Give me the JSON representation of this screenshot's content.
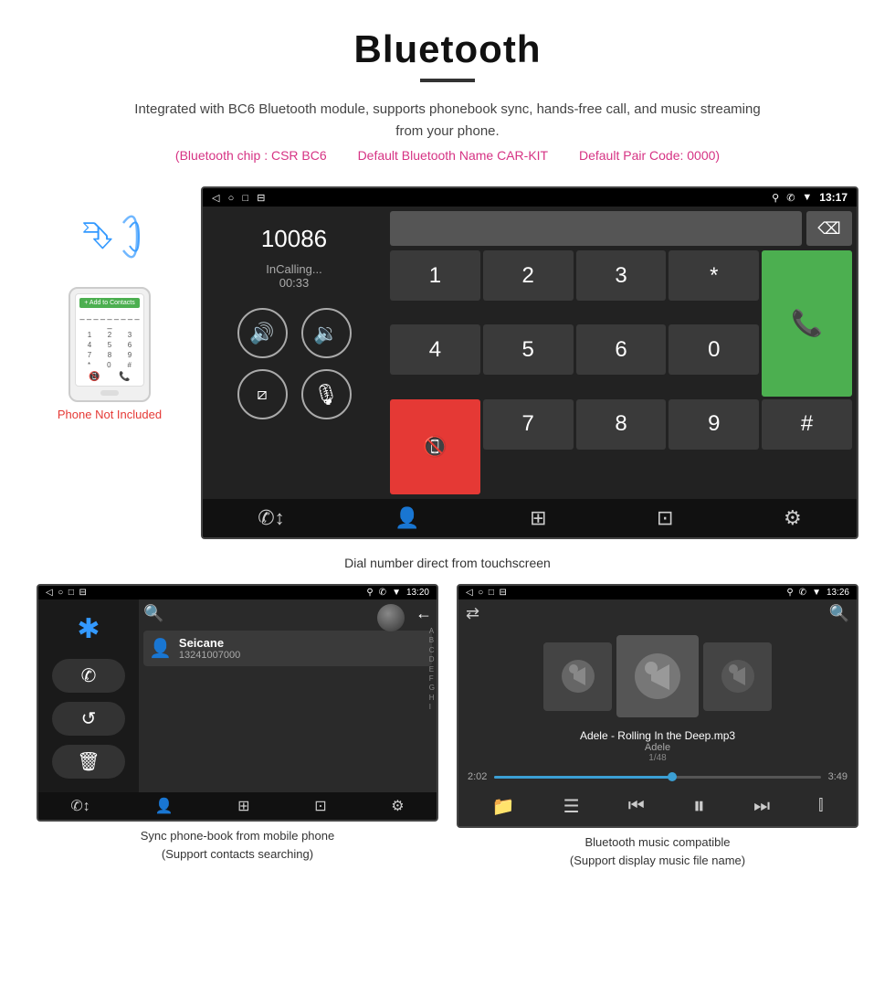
{
  "header": {
    "title": "Bluetooth",
    "description": "Integrated with BC6 Bluetooth module, supports phonebook sync, hands-free call, and music streaming from your phone.",
    "spec_chip": "(Bluetooth chip : CSR BC6",
    "spec_name": "Default Bluetooth Name CAR-KIT",
    "spec_code": "Default Pair Code: 0000)",
    "underline": true
  },
  "dial_screen": {
    "status_bar": {
      "left_icons": "◁  ○  □  ⊟",
      "right_icons": "♥  ✆  ▼",
      "time": "13:17"
    },
    "number": "10086",
    "status": "InCalling...",
    "timer": "00:33",
    "keys": [
      "1",
      "2",
      "3",
      "*",
      "4",
      "5",
      "6",
      "0",
      "7",
      "8",
      "9",
      "#"
    ],
    "caption": "Dial number direct from touchscreen"
  },
  "phonebook_screen": {
    "status_bar": {
      "left_icons": "◁  ○  □  ⊟",
      "right_icons": "♥  ✆  ▼",
      "time": "13:20"
    },
    "contact_name": "Seicane",
    "contact_number": "13241007000",
    "alpha_list": [
      "A",
      "B",
      "C",
      "D",
      "E",
      "F",
      "G",
      "H",
      "I"
    ],
    "caption_line1": "Sync phone-book from mobile phone",
    "caption_line2": "(Support contacts searching)"
  },
  "music_screen": {
    "status_bar": {
      "left_icons": "◁  ○  □  ⊟",
      "right_icons": "♥  ✆  ▼",
      "time": "13:26"
    },
    "song_title": "Adele - Rolling In the Deep.mp3",
    "artist": "Adele",
    "track_info": "1/48",
    "time_current": "2:02",
    "time_total": "3:49",
    "caption_line1": "Bluetooth music compatible",
    "caption_line2": "(Support display music file name)"
  },
  "phone_illustration": {
    "not_included": "Phone Not Included"
  },
  "bottom_nav_icons": {
    "call": "✆",
    "contact": "👤",
    "grid": "⊞",
    "transfer": "⊡",
    "settings": "⚙"
  }
}
